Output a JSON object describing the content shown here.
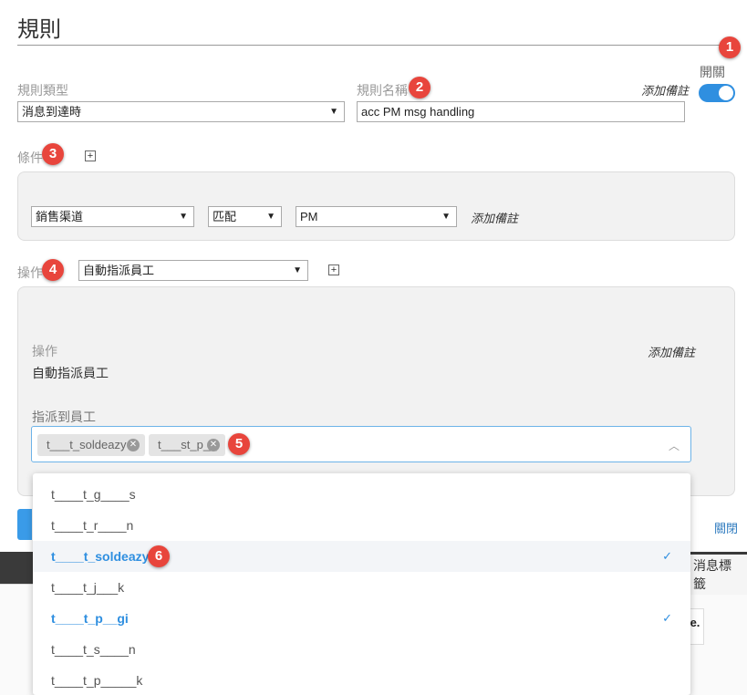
{
  "modal": {
    "title": "規則",
    "rule_type": {
      "label": "規則類型",
      "value": "消息到達時"
    },
    "rule_name": {
      "label": "規則名稱",
      "value": "acc PM msg handling",
      "add_note": "添加備註"
    },
    "enabled": {
      "label": "開關",
      "on": true
    },
    "conditions": {
      "label": "條件",
      "row": {
        "field": "銷售渠道",
        "operator": "匹配",
        "value": "PM",
        "add_note": "添加備註"
      }
    },
    "action": {
      "label": "操作",
      "selected": "自動指派員工",
      "panel": {
        "heading": "操作",
        "value": "自動指派員工",
        "add_note": "添加備註",
        "assign_label": "指派到員工",
        "selected_tags": [
          "t___t_soldeazy",
          "t___st_p__"
        ]
      }
    },
    "close_label": "關閉"
  },
  "dropdown": {
    "items": [
      {
        "label": "t____t_g____s",
        "selected": false
      },
      {
        "label": "t____t_r____n",
        "selected": false
      },
      {
        "label": "t____t_soldeazy",
        "selected": true
      },
      {
        "label": "t____t_j___k",
        "selected": false
      },
      {
        "label": "t____t_p__gi",
        "selected": true
      },
      {
        "label": "t____t_s____n",
        "selected": false
      },
      {
        "label": "t____t_p_____k",
        "selected": false
      }
    ]
  },
  "background": {
    "tab_label": "消息標籤",
    "logo_text": "e."
  },
  "markers": [
    "1",
    "2",
    "3",
    "4",
    "5",
    "6"
  ],
  "colors": {
    "accent": "#2f8fe0",
    "marker": "#e8453c",
    "panel": "#f2f2f2"
  }
}
